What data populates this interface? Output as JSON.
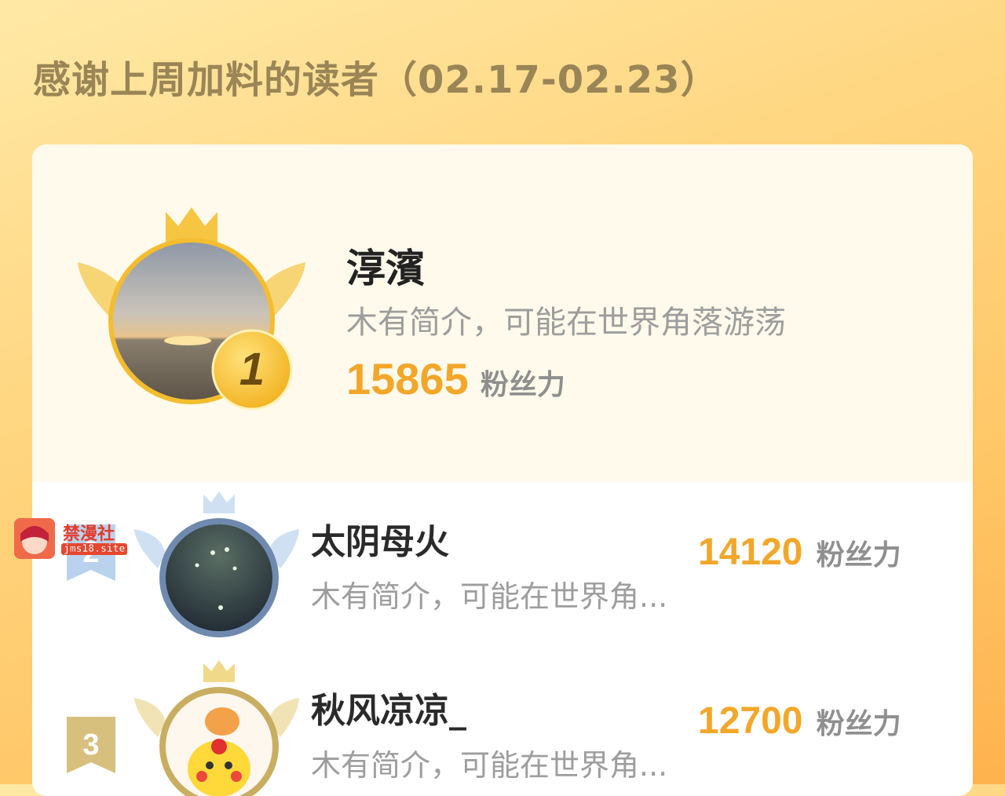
{
  "header": {
    "title": "感谢上周加料的读者（02.17-02.23）"
  },
  "fans": [
    {
      "rank": "1",
      "name": "淳濱",
      "bio": "木有简介，可能在世界角落游荡",
      "score": "15865",
      "unit": "粉丝力"
    },
    {
      "rank": "2",
      "name": "太阴母火",
      "bio": "木有简介，可能在世界角...",
      "score": "14120",
      "unit": "粉丝力"
    },
    {
      "rank": "3",
      "name": "秋风凉凉_",
      "bio": "木有简介，可能在世界角...",
      "score": "12700",
      "unit": "粉丝力"
    }
  ],
  "watermark": {
    "text": "禁漫社",
    "url": "jms18.site"
  },
  "colors": {
    "accent": "#f2a72b",
    "gold": "#f6c542",
    "silver": "#a9c4e2",
    "bronze": "#d8c07a"
  }
}
